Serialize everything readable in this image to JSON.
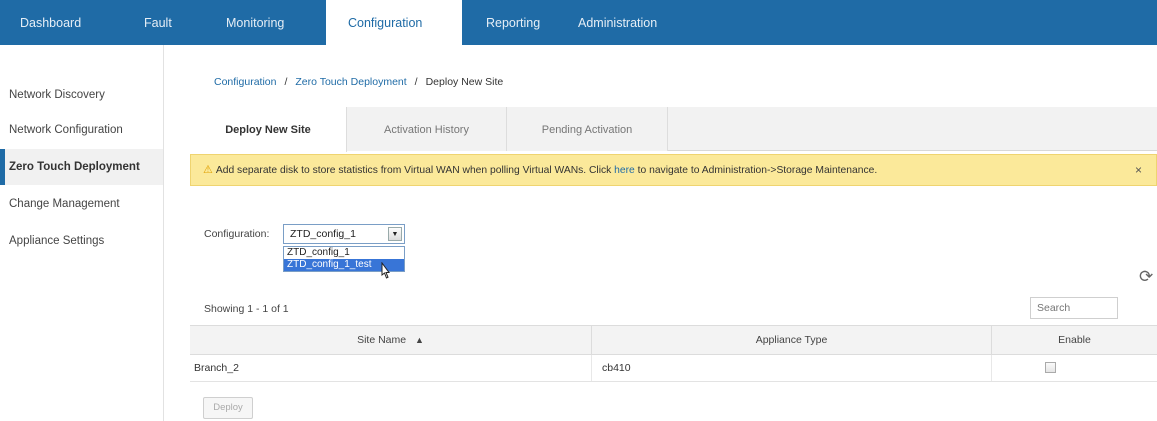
{
  "topnav": {
    "tabs": [
      {
        "label": "Dashboard"
      },
      {
        "label": "Fault"
      },
      {
        "label": "Monitoring"
      },
      {
        "label": "Configuration",
        "active": true
      },
      {
        "label": "Reporting"
      },
      {
        "label": "Administration"
      }
    ]
  },
  "sidebar": {
    "items": [
      {
        "label": "Network Discovery"
      },
      {
        "label": "Network Configuration"
      },
      {
        "label": "Zero Touch Deployment",
        "active": true
      },
      {
        "label": "Change Management"
      },
      {
        "label": "Appliance Settings"
      }
    ]
  },
  "breadcrumb": {
    "items": [
      "Configuration",
      "Zero Touch Deployment",
      "Deploy New Site"
    ],
    "separator": "/"
  },
  "subtabs": [
    {
      "label": "Deploy New Site",
      "active": true
    },
    {
      "label": "Activation History"
    },
    {
      "label": "Pending Activation"
    }
  ],
  "alert": {
    "icon": "warning-icon",
    "text_before": "Add separate disk to store statistics from Virtual WAN when polling Virtual WANs. Click ",
    "link": "here",
    "text_after": " to navigate to Administration->Storage Maintenance.",
    "close": "×"
  },
  "config": {
    "label": "Configuration:",
    "selected": "ZTD_config_1",
    "options": [
      "ZTD_config_1",
      "ZTD_config_1_test"
    ],
    "highlighted_index": 1
  },
  "table": {
    "showing": "Showing 1 - 1 of 1",
    "search_placeholder": "Search",
    "columns": [
      "Site Name",
      "Appliance Type",
      "Enable"
    ],
    "sort_column": "Site Name",
    "sort_direction": "ascending",
    "rows": [
      {
        "site_name": "Branch_2",
        "appliance_type": "cb410",
        "enable": false
      }
    ]
  },
  "deploy_label": "Deploy",
  "colors": {
    "nav_bg": "#1f6ba6",
    "alert_bg": "#fbe99a",
    "selected_option": "#3875d7"
  }
}
